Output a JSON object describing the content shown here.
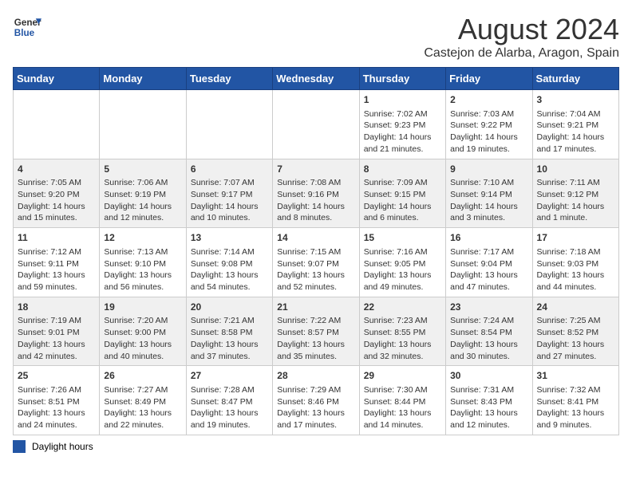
{
  "header": {
    "logo_general": "General",
    "logo_blue": "Blue",
    "title": "August 2024",
    "subtitle": "Castejon de Alarba, Aragon, Spain"
  },
  "days_of_week": [
    "Sunday",
    "Monday",
    "Tuesday",
    "Wednesday",
    "Thursday",
    "Friday",
    "Saturday"
  ],
  "weeks": [
    [
      {
        "day": "",
        "info": ""
      },
      {
        "day": "",
        "info": ""
      },
      {
        "day": "",
        "info": ""
      },
      {
        "day": "",
        "info": ""
      },
      {
        "day": "1",
        "info": "Sunrise: 7:02 AM\nSunset: 9:23 PM\nDaylight: 14 hours\nand 21 minutes."
      },
      {
        "day": "2",
        "info": "Sunrise: 7:03 AM\nSunset: 9:22 PM\nDaylight: 14 hours\nand 19 minutes."
      },
      {
        "day": "3",
        "info": "Sunrise: 7:04 AM\nSunset: 9:21 PM\nDaylight: 14 hours\nand 17 minutes."
      }
    ],
    [
      {
        "day": "4",
        "info": "Sunrise: 7:05 AM\nSunset: 9:20 PM\nDaylight: 14 hours\nand 15 minutes."
      },
      {
        "day": "5",
        "info": "Sunrise: 7:06 AM\nSunset: 9:19 PM\nDaylight: 14 hours\nand 12 minutes."
      },
      {
        "day": "6",
        "info": "Sunrise: 7:07 AM\nSunset: 9:17 PM\nDaylight: 14 hours\nand 10 minutes."
      },
      {
        "day": "7",
        "info": "Sunrise: 7:08 AM\nSunset: 9:16 PM\nDaylight: 14 hours\nand 8 minutes."
      },
      {
        "day": "8",
        "info": "Sunrise: 7:09 AM\nSunset: 9:15 PM\nDaylight: 14 hours\nand 6 minutes."
      },
      {
        "day": "9",
        "info": "Sunrise: 7:10 AM\nSunset: 9:14 PM\nDaylight: 14 hours\nand 3 minutes."
      },
      {
        "day": "10",
        "info": "Sunrise: 7:11 AM\nSunset: 9:12 PM\nDaylight: 14 hours\nand 1 minute."
      }
    ],
    [
      {
        "day": "11",
        "info": "Sunrise: 7:12 AM\nSunset: 9:11 PM\nDaylight: 13 hours\nand 59 minutes."
      },
      {
        "day": "12",
        "info": "Sunrise: 7:13 AM\nSunset: 9:10 PM\nDaylight: 13 hours\nand 56 minutes."
      },
      {
        "day": "13",
        "info": "Sunrise: 7:14 AM\nSunset: 9:08 PM\nDaylight: 13 hours\nand 54 minutes."
      },
      {
        "day": "14",
        "info": "Sunrise: 7:15 AM\nSunset: 9:07 PM\nDaylight: 13 hours\nand 52 minutes."
      },
      {
        "day": "15",
        "info": "Sunrise: 7:16 AM\nSunset: 9:05 PM\nDaylight: 13 hours\nand 49 minutes."
      },
      {
        "day": "16",
        "info": "Sunrise: 7:17 AM\nSunset: 9:04 PM\nDaylight: 13 hours\nand 47 minutes."
      },
      {
        "day": "17",
        "info": "Sunrise: 7:18 AM\nSunset: 9:03 PM\nDaylight: 13 hours\nand 44 minutes."
      }
    ],
    [
      {
        "day": "18",
        "info": "Sunrise: 7:19 AM\nSunset: 9:01 PM\nDaylight: 13 hours\nand 42 minutes."
      },
      {
        "day": "19",
        "info": "Sunrise: 7:20 AM\nSunset: 9:00 PM\nDaylight: 13 hours\nand 40 minutes."
      },
      {
        "day": "20",
        "info": "Sunrise: 7:21 AM\nSunset: 8:58 PM\nDaylight: 13 hours\nand 37 minutes."
      },
      {
        "day": "21",
        "info": "Sunrise: 7:22 AM\nSunset: 8:57 PM\nDaylight: 13 hours\nand 35 minutes."
      },
      {
        "day": "22",
        "info": "Sunrise: 7:23 AM\nSunset: 8:55 PM\nDaylight: 13 hours\nand 32 minutes."
      },
      {
        "day": "23",
        "info": "Sunrise: 7:24 AM\nSunset: 8:54 PM\nDaylight: 13 hours\nand 30 minutes."
      },
      {
        "day": "24",
        "info": "Sunrise: 7:25 AM\nSunset: 8:52 PM\nDaylight: 13 hours\nand 27 minutes."
      }
    ],
    [
      {
        "day": "25",
        "info": "Sunrise: 7:26 AM\nSunset: 8:51 PM\nDaylight: 13 hours\nand 24 minutes."
      },
      {
        "day": "26",
        "info": "Sunrise: 7:27 AM\nSunset: 8:49 PM\nDaylight: 13 hours\nand 22 minutes."
      },
      {
        "day": "27",
        "info": "Sunrise: 7:28 AM\nSunset: 8:47 PM\nDaylight: 13 hours\nand 19 minutes."
      },
      {
        "day": "28",
        "info": "Sunrise: 7:29 AM\nSunset: 8:46 PM\nDaylight: 13 hours\nand 17 minutes."
      },
      {
        "day": "29",
        "info": "Sunrise: 7:30 AM\nSunset: 8:44 PM\nDaylight: 13 hours\nand 14 minutes."
      },
      {
        "day": "30",
        "info": "Sunrise: 7:31 AM\nSunset: 8:43 PM\nDaylight: 13 hours\nand 12 minutes."
      },
      {
        "day": "31",
        "info": "Sunrise: 7:32 AM\nSunset: 8:41 PM\nDaylight: 13 hours\nand 9 minutes."
      }
    ]
  ],
  "footer": {
    "legend_label": "Daylight hours"
  }
}
